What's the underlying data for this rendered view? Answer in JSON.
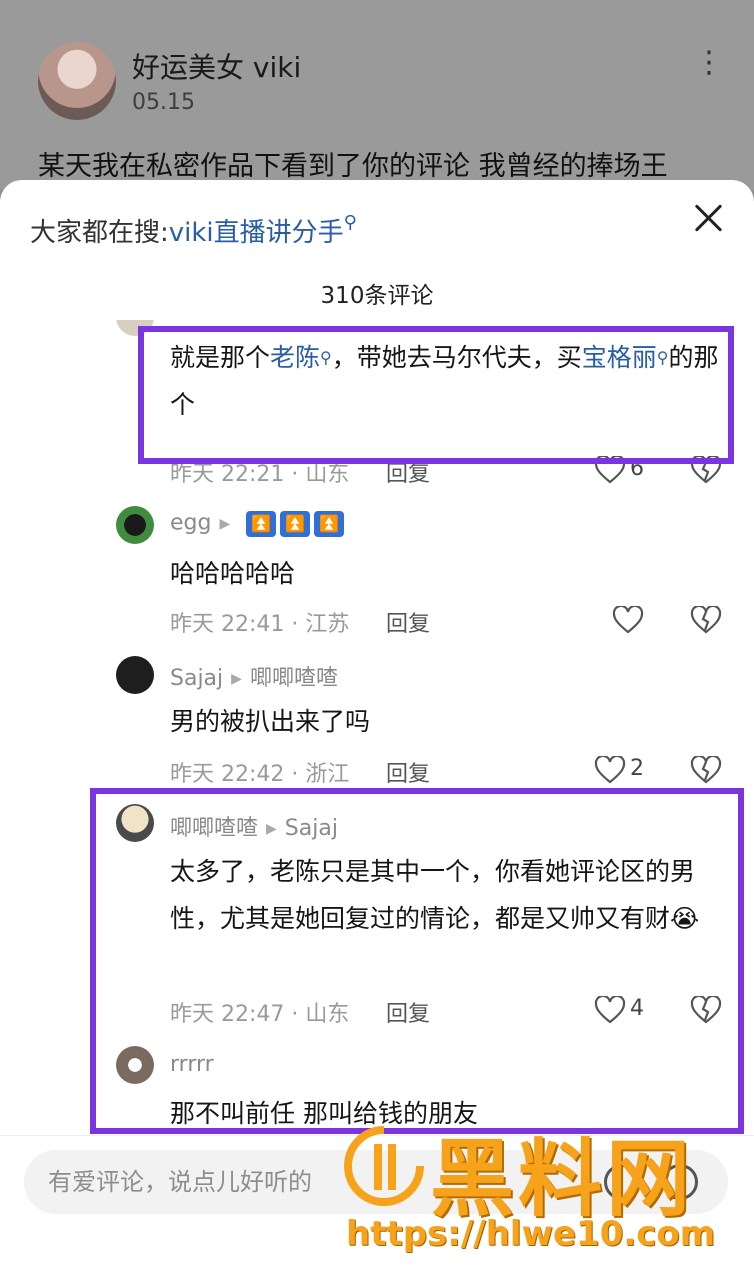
{
  "post": {
    "author": "好运美女 viki",
    "date": "05.15",
    "text": "某天我在私密作品下看到了你的评论 我曾经的捧场王"
  },
  "sheet": {
    "hot_search_prefix": "大家都在搜:",
    "hot_search_keyword": "viki直播讲分手",
    "comment_count": "310条评论"
  },
  "comments": [
    {
      "body_parts": [
        "就是那个",
        "老陈",
        "，带她去马尔代夫，买",
        "宝格丽",
        "的那个"
      ],
      "time": "昨天 22:21 · 山东",
      "reply": "回复",
      "likes": "6"
    },
    {
      "user": "egg",
      "badges": [
        "⏫",
        "⏫",
        "⏫"
      ],
      "body": "哈哈哈哈哈",
      "time": "昨天 22:41 · 江苏",
      "reply": "回复",
      "likes": ""
    },
    {
      "user": "Sajaj",
      "reply_to": "唧唧喳喳",
      "body": "男的被扒出来了吗",
      "time": "昨天 22:42 · 浙江",
      "reply": "回复",
      "likes": "2"
    },
    {
      "user": "唧唧喳喳",
      "reply_to": "Sajaj",
      "body": "太多了，老陈只是其中一个，你看她评论区的男性，尤其是她回复过的情论，都是又帅又有财😭",
      "time": "昨天 22:47 · 山东",
      "reply": "回复",
      "likes": "4"
    },
    {
      "user": "rrrrr",
      "body": "那不叫前任  那叫给钱的朋友"
    }
  ],
  "footer": {
    "input_placeholder": "有爱评论，说点儿好听的"
  },
  "watermark": {
    "title": "黑料网",
    "url": "https://hlwe10.com"
  },
  "colors": {
    "highlight": "#7a35e0",
    "link": "#2a5da8",
    "watermark": "#f7a21b"
  }
}
